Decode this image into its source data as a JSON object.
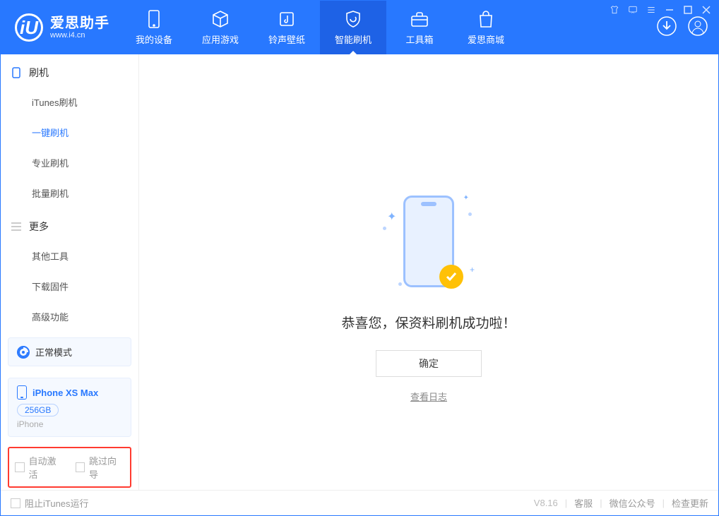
{
  "app": {
    "name": "爱思助手",
    "url": "www.i4.cn"
  },
  "nav": {
    "items": [
      {
        "label": "我的设备"
      },
      {
        "label": "应用游戏"
      },
      {
        "label": "铃声壁纸"
      },
      {
        "label": "智能刷机"
      },
      {
        "label": "工具箱"
      },
      {
        "label": "爱思商城"
      }
    ],
    "active_index": 3
  },
  "sidebar": {
    "section1": {
      "title": "刷机",
      "items": [
        "iTunes刷机",
        "一键刷机",
        "专业刷机",
        "批量刷机"
      ],
      "active_index": 1
    },
    "section2": {
      "title": "更多",
      "items": [
        "其他工具",
        "下载固件",
        "高级功能"
      ]
    },
    "mode": {
      "label": "正常模式"
    },
    "device": {
      "name": "iPhone XS Max",
      "capacity": "256GB",
      "type": "iPhone"
    },
    "checkboxes": {
      "auto_activate": "自动激活",
      "skip_guide": "跳过向导"
    }
  },
  "main": {
    "success": "恭喜您，保资料刷机成功啦！",
    "confirm": "确定",
    "view_log": "查看日志"
  },
  "footer": {
    "block_itunes": "阻止iTunes运行",
    "version": "V8.16",
    "links": [
      "客服",
      "微信公众号",
      "检查更新"
    ]
  }
}
